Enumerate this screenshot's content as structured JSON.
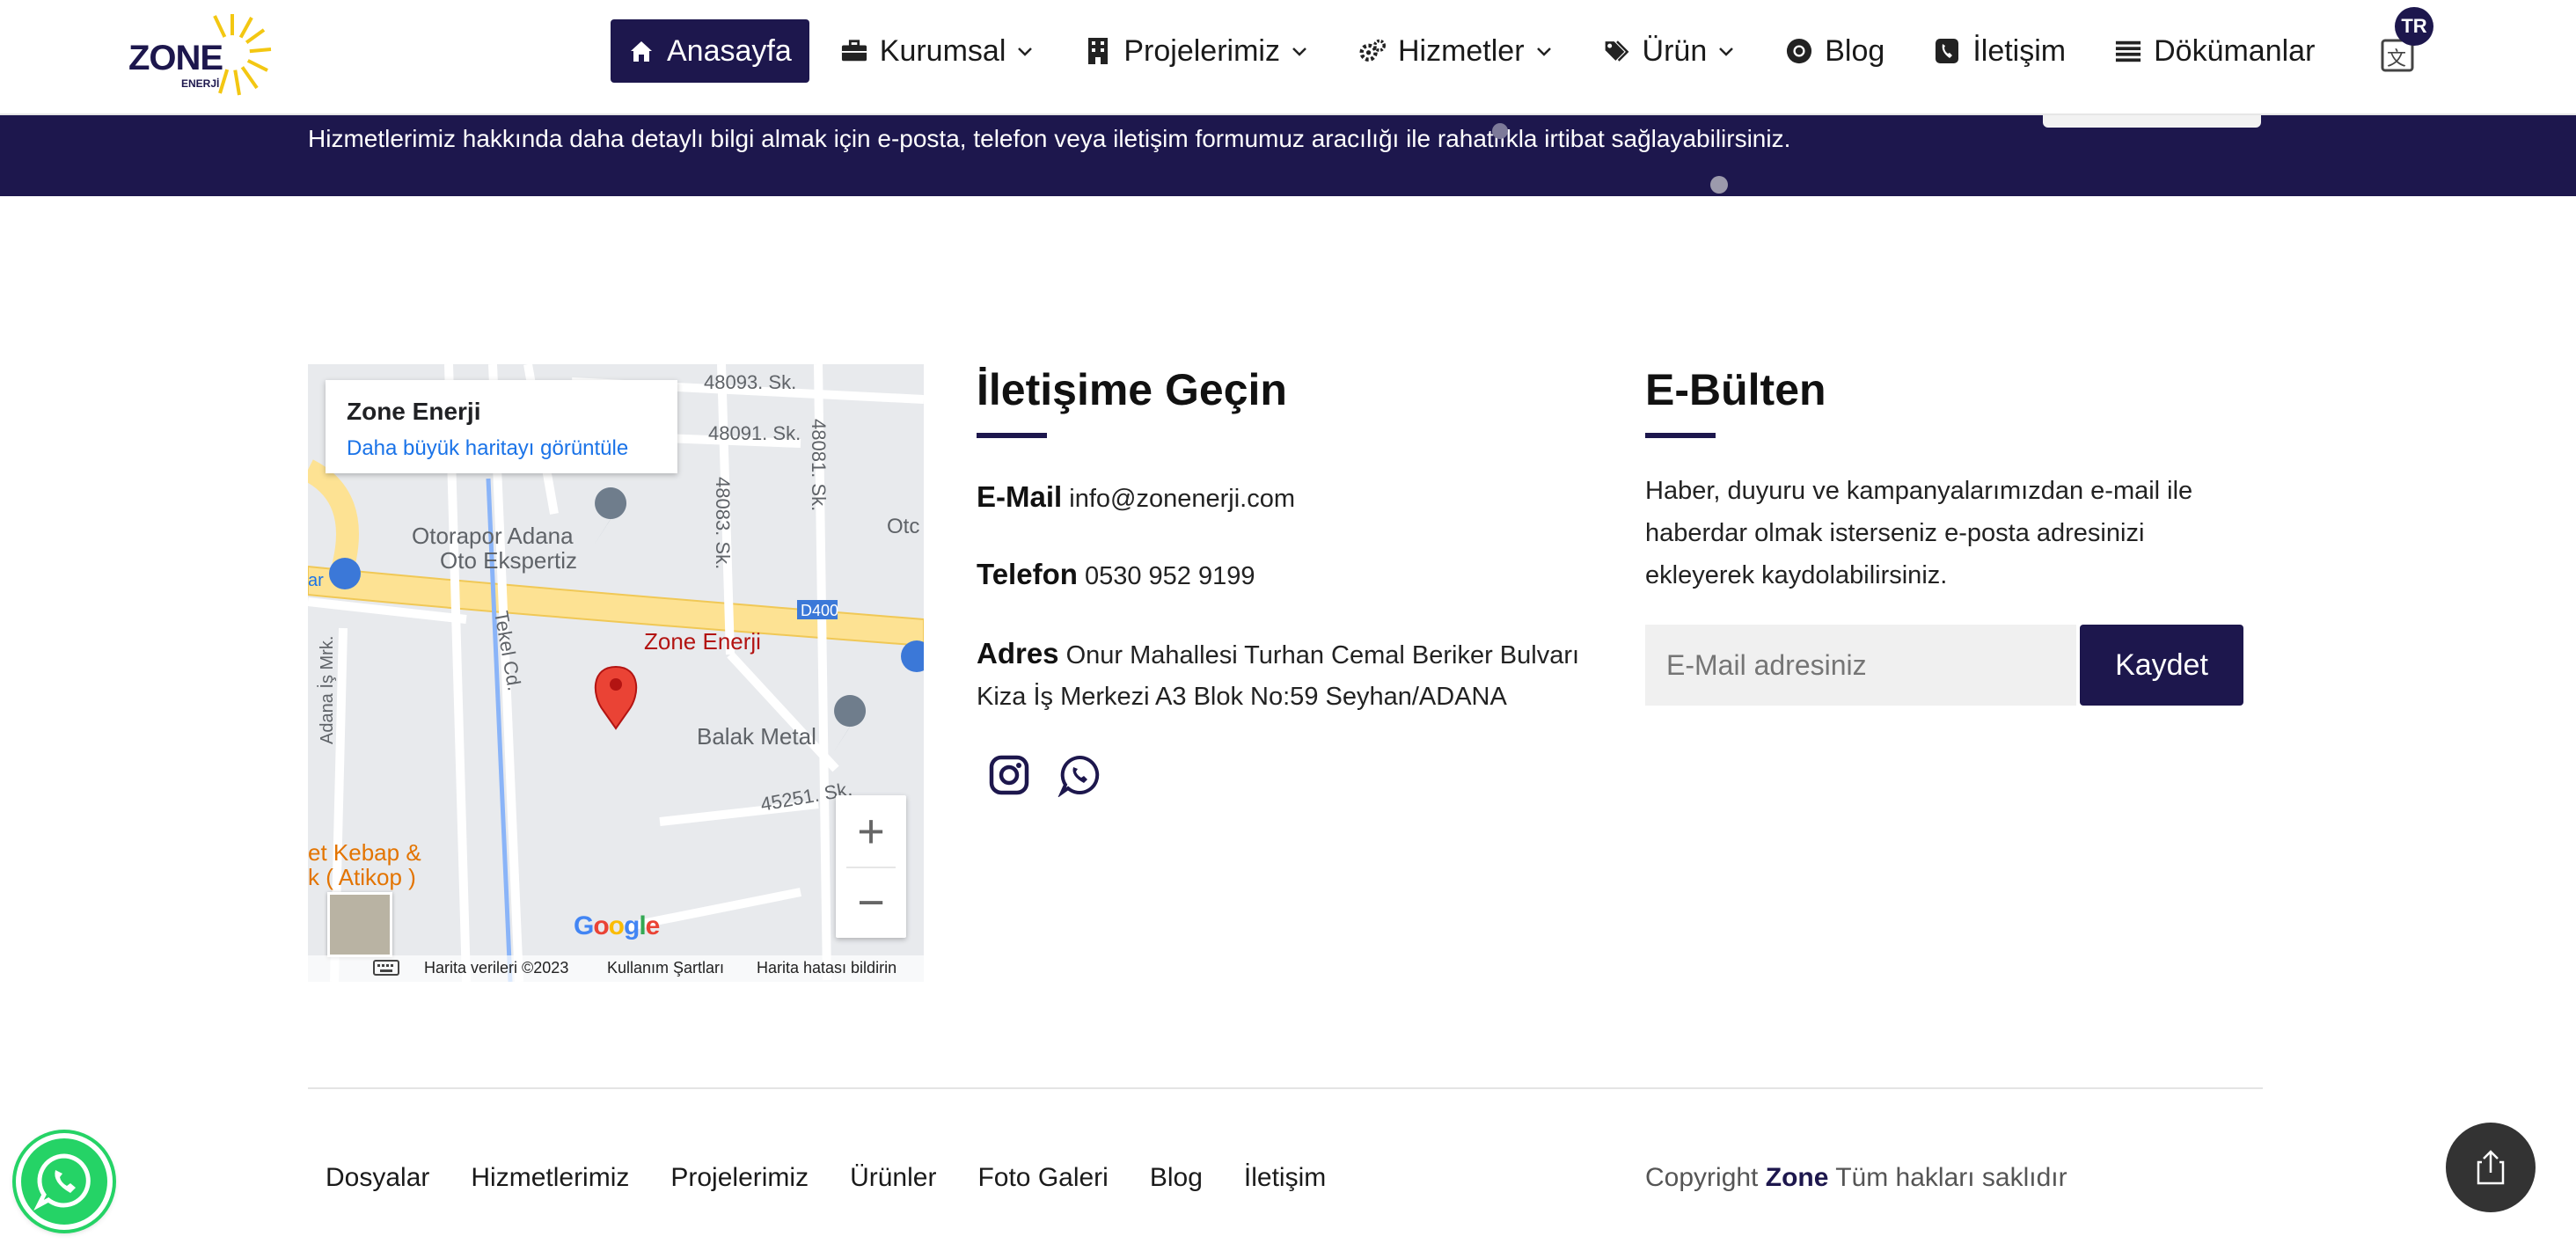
{
  "brand": {
    "logo_text": "ZONE",
    "logo_sub": "ENERJİ",
    "accent": "#1d174d"
  },
  "nav": {
    "items": [
      {
        "label": "Anasayfa",
        "icon": "home-icon",
        "active": true
      },
      {
        "label": "Kurumsal",
        "icon": "briefcase-icon",
        "dropdown": true
      },
      {
        "label": "Projelerimiz",
        "icon": "building-icon",
        "dropdown": true
      },
      {
        "label": "Hizmetler",
        "icon": "gears-icon",
        "dropdown": true
      },
      {
        "label": "Ürün",
        "icon": "tags-icon",
        "dropdown": true
      },
      {
        "label": "Blog",
        "icon": "chrome-icon"
      },
      {
        "label": "İletişim",
        "icon": "phone-icon"
      },
      {
        "label": "Dökümanlar",
        "icon": "list-icon"
      }
    ],
    "lang_badge": "TR"
  },
  "banner": {
    "text": "Hizmetlerimiz hakkında daha detaylı bilgi almak için e-posta, telefon veya iletişim formumuz aracılığı ile rahatlıkla irtibat sağlayabilirsiniz."
  },
  "map": {
    "place_title": "Zone Enerji",
    "place_link": "Daha büyük haritayı görüntüle",
    "pin_label": "Zone Enerji",
    "labels": [
      "48093. Sk.",
      "48091. Sk.",
      "48081. Sk.",
      "Otorapor Adana",
      "Oto Ekspertiz",
      "48083. Sk.",
      "Tekel Cd.",
      "Adana İş Mrk.",
      "D400",
      "Balak Metal",
      "45251. Sk.",
      "et Kebap &",
      "k ( Atikop )",
      "Otc",
      "ar"
    ],
    "google": "Google",
    "footer_data": "Harita verileri ©2023",
    "footer_terms": "Kullanım Şartları",
    "footer_report": "Harita hatası bildirin",
    "zoom_in": "+",
    "zoom_out": "−"
  },
  "contact": {
    "title": "İletişime Geçin",
    "email_label": "E-Mail",
    "email": "info@zonenerji.com",
    "phone_label": "Telefon",
    "phone": "0530 952 9199",
    "address_label": "Adres",
    "address_line1": "Onur Mahallesi Turhan Cemal Beriker Bulvarı",
    "address_line2": "Kiza İş Merkezi A3 Blok No:59 Seyhan/ADANA"
  },
  "newsletter": {
    "title": "E-Bülten",
    "text": "Haber, duyuru ve kampanyalarımızdan e-mail ile haberdar olmak isterseniz e-posta adresinizi ekleyerek kaydolabilirsiniz.",
    "placeholder": "E-Mail adresiniz",
    "button": "Kaydet"
  },
  "footer": {
    "links": [
      "Dosyalar",
      "Hizmetlerimiz",
      "Projelerimiz",
      "Ürünler",
      "Foto Galeri",
      "Blog",
      "İletişim"
    ],
    "copyright_prefix": "Copyright",
    "copyright_brand": "Zone",
    "copyright_suffix": "Tüm hakları saklıdır"
  }
}
